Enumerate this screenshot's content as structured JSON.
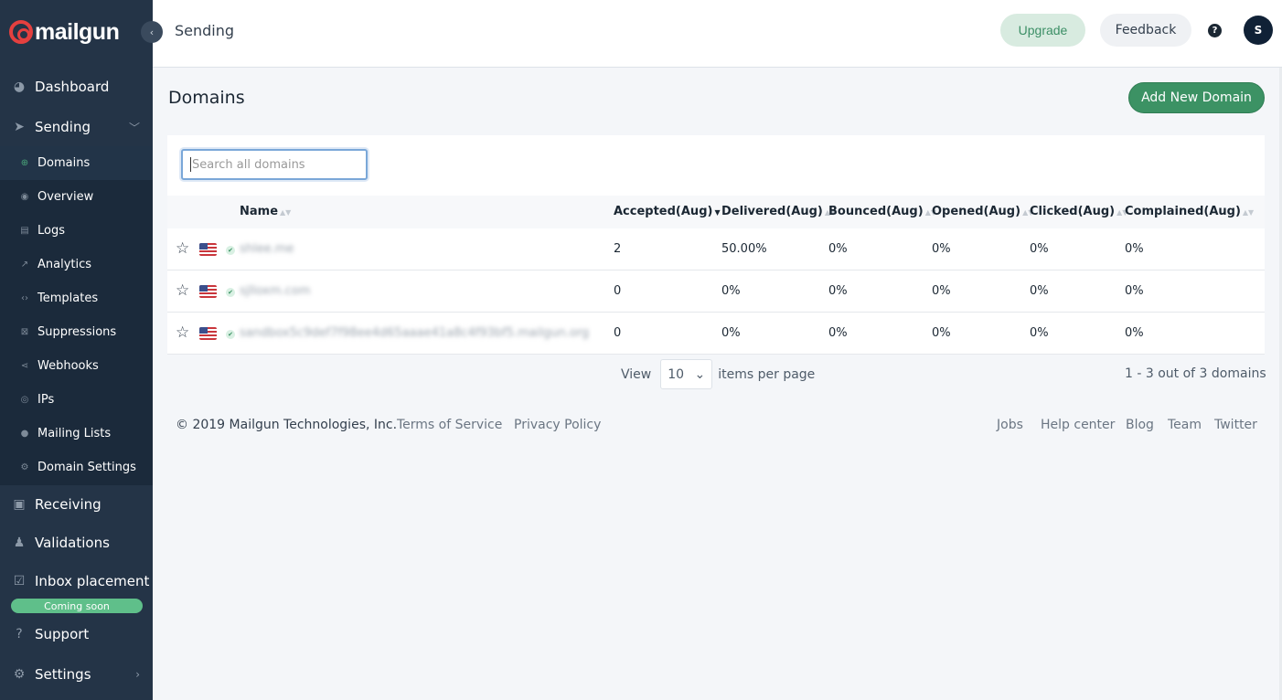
{
  "brand": {
    "name": "mailgun"
  },
  "header": {
    "title": "Sending",
    "upgrade": "Upgrade",
    "feedback": "Feedback",
    "help": "?",
    "avatar_initial": "S"
  },
  "sidebar": {
    "top": [
      {
        "label": "Dashboard",
        "icon": "dashboard-icon"
      },
      {
        "label": "Sending",
        "icon": "paper-plane-icon",
        "expanded": true
      }
    ],
    "sub": [
      {
        "label": "Domains",
        "icon": "globe-icon",
        "active": true
      },
      {
        "label": "Overview",
        "icon": "eye-icon"
      },
      {
        "label": "Logs",
        "icon": "log-icon"
      },
      {
        "label": "Analytics",
        "icon": "analytics-icon"
      },
      {
        "label": "Templates",
        "icon": "code-icon"
      },
      {
        "label": "Suppressions",
        "icon": "suppression-icon"
      },
      {
        "label": "Webhooks",
        "icon": "webhook-icon"
      },
      {
        "label": "IPs",
        "icon": "ip-icon"
      },
      {
        "label": "Mailing Lists",
        "icon": "person-icon"
      },
      {
        "label": "Domain Settings",
        "icon": "gear-icon"
      }
    ],
    "bottom": [
      {
        "label": "Receiving",
        "icon": "inbox-icon"
      },
      {
        "label": "Validations",
        "icon": "user-check-icon"
      },
      {
        "label": "Inbox placement",
        "icon": "checkbox-icon",
        "badge": "Coming soon"
      },
      {
        "label": "Support",
        "icon": "question-icon"
      },
      {
        "label": "Settings",
        "icon": "gear-icon"
      }
    ]
  },
  "main": {
    "title": "Domains",
    "add_button": "Add New Domain",
    "search": {
      "placeholder": "Search all domains",
      "value": ""
    },
    "columns": [
      "Name",
      "Accepted(Aug)",
      "Delivered(Aug)",
      "Bounced(Aug)",
      "Opened(Aug)",
      "Clicked(Aug)",
      "Complained(Aug)"
    ],
    "rows": [
      {
        "name": "shlee.me",
        "accepted": "2",
        "delivered": "50.00%",
        "bounced": "0%",
        "opened": "0%",
        "clicked": "0%",
        "complained": "0%"
      },
      {
        "name": "sjlloxm.com",
        "accepted": "0",
        "delivered": "0%",
        "bounced": "0%",
        "opened": "0%",
        "clicked": "0%",
        "complained": "0%"
      },
      {
        "name": "sandbox5c9def7f98ee4d65aaae41a8c4f93bf5.mailgun.org",
        "accepted": "0",
        "delivered": "0%",
        "bounced": "0%",
        "opened": "0%",
        "clicked": "0%",
        "complained": "0%"
      }
    ],
    "pager": {
      "view_label": "View",
      "per_page": "10",
      "per_page_label": "items per page",
      "range": "1 - 3 out of 3 domains"
    }
  },
  "footer": {
    "copyright": "© 2019 Mailgun Technologies, Inc.",
    "left_links": [
      "Terms of Service",
      "Privacy Policy"
    ],
    "right_links": [
      "Jobs",
      "Help center",
      "Blog",
      "Team",
      "Twitter"
    ]
  },
  "colors": {
    "sidebar": "#243447",
    "accent": "#3c9264",
    "logo": "#e4403f"
  }
}
